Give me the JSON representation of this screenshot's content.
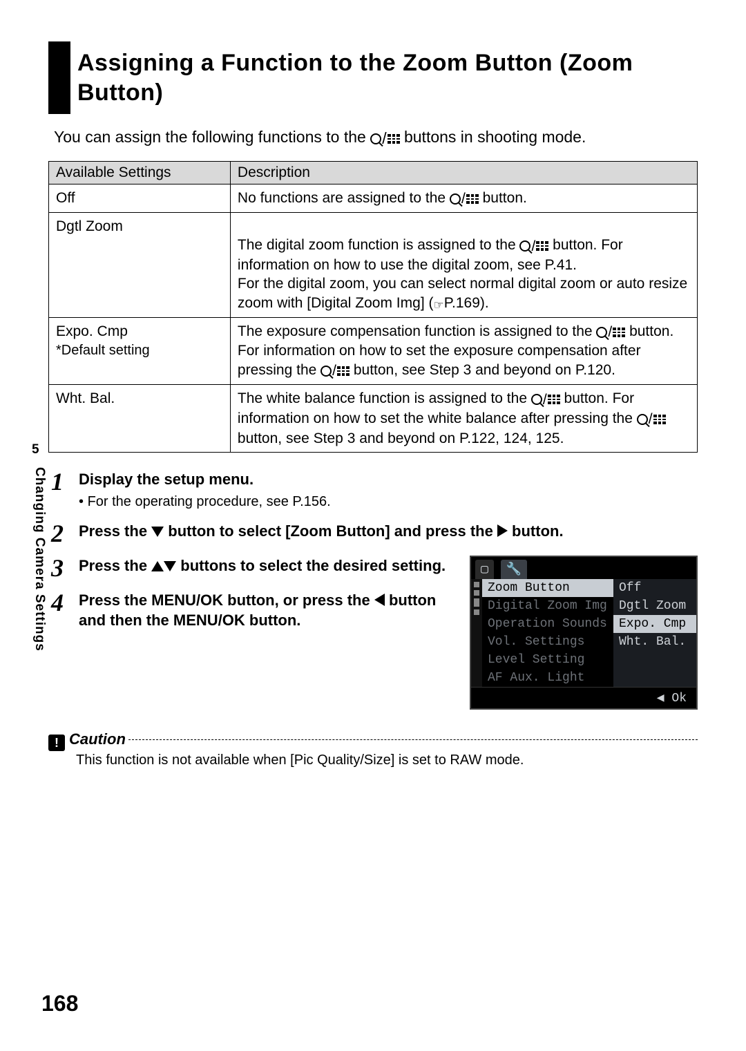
{
  "sidebar": {
    "chapter": "5",
    "label": "Changing Camera Settings"
  },
  "page_number": "168",
  "title": "Assigning a Function to the Zoom Button (Zoom Button)",
  "intro_pre": "You can assign the following functions to the ",
  "intro_post": " buttons in shooting mode.",
  "table": {
    "headers": [
      "Available Settings",
      "Description"
    ],
    "rows": [
      {
        "setting": "Off",
        "desc_pre": "No functions are assigned to the ",
        "desc_post": " button."
      },
      {
        "setting": "Dgtl Zoom",
        "desc_pre": "The digital zoom function is assigned to the ",
        "desc_mid": " button. For information on how to use the digital zoom, see P.41.\nFor the digital zoom, you can select normal digital zoom or auto resize zoom with [Digital Zoom Img] (",
        "desc_post": "P.169)."
      },
      {
        "setting": "Expo. Cmp",
        "setting_sub": "*Default setting",
        "desc_pre": "The exposure compensation function is assigned to the ",
        "desc_mid": " button. For information on how to set the exposure compensation after pressing the ",
        "desc_post": " button, see Step 3 and beyond on P.120."
      },
      {
        "setting": "Wht. Bal.",
        "desc_pre": "The white balance function is assigned to the ",
        "desc_mid": " button. For information on how to set the white balance after pressing the ",
        "desc_post": " button, see Step 3 and beyond on P.122, 124, 125."
      }
    ]
  },
  "steps": [
    {
      "num": "1",
      "title": "Display the setup menu.",
      "bullet": "For the operating procedure, see P.156."
    },
    {
      "num": "2",
      "title_pre": "Press the ",
      "title_mid": " button to select [Zoom Button] and press the ",
      "title_post": " button."
    },
    {
      "num": "3",
      "title_pre": "Press the ",
      "title_post": " buttons to select the desired setting."
    },
    {
      "num": "4",
      "title_pre": "Press the MENU/OK button, or press the ",
      "title_post": " button and then the MENU/OK button."
    }
  ],
  "lcd": {
    "tab_icons": [
      "camera-icon",
      "wrench-icon"
    ],
    "menu": [
      {
        "left": "Zoom Button",
        "right": "Off",
        "selected_left": true
      },
      {
        "left": "Digital Zoom Img",
        "right": "Dgtl Zoom"
      },
      {
        "left": "Operation Sounds",
        "right": "Expo. Cmp",
        "selected_right": true
      },
      {
        "left": "Vol. Settings",
        "right": "Wht. Bal."
      },
      {
        "left": "Level Setting",
        "right": ""
      },
      {
        "left": "AF Aux. Light",
        "right": ""
      }
    ],
    "ok": "◀ Ok"
  },
  "caution": {
    "icon": "!",
    "label": "Caution",
    "text": "This function is not available when [Pic Quality/Size] is set to RAW mode."
  }
}
